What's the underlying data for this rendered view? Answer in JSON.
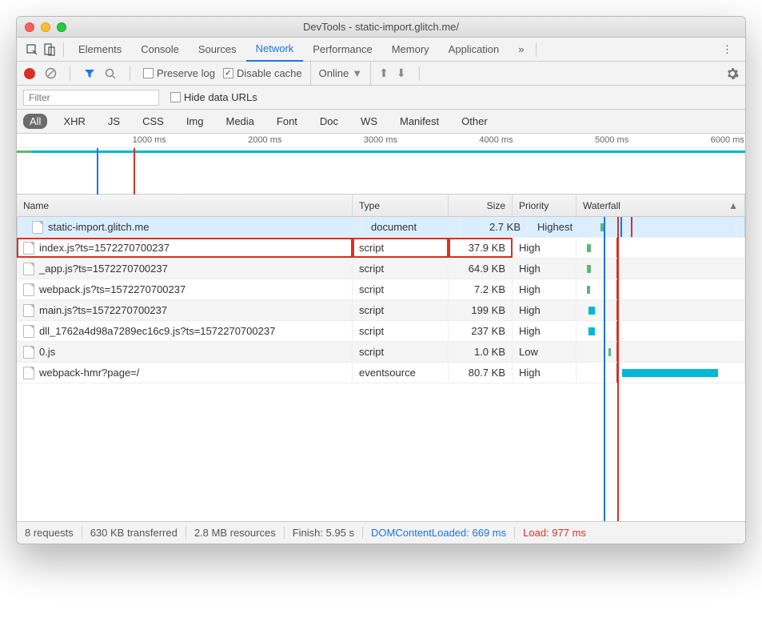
{
  "window": {
    "title": "DevTools - static-import.glitch.me/"
  },
  "tabs": [
    "Elements",
    "Console",
    "Sources",
    "Network",
    "Performance",
    "Memory",
    "Application"
  ],
  "activeTab": "Network",
  "toolbar": {
    "preserve_log": "Preserve log",
    "disable_cache": "Disable cache",
    "throttle": "Online"
  },
  "filter": {
    "placeholder": "Filter",
    "hide_urls": "Hide data URLs"
  },
  "types": [
    "All",
    "XHR",
    "JS",
    "CSS",
    "Img",
    "Media",
    "Font",
    "Doc",
    "WS",
    "Manifest",
    "Other"
  ],
  "activeType": "All",
  "overview": {
    "ticks": [
      "1000 ms",
      "2000 ms",
      "3000 ms",
      "4000 ms",
      "5000 ms",
      "6000 ms"
    ]
  },
  "columns": {
    "name": "Name",
    "type": "Type",
    "size": "Size",
    "priority": "Priority",
    "waterfall": "Waterfall"
  },
  "rows": [
    {
      "name": "static-import.glitch.me",
      "type": "document",
      "size": "2.7 KB",
      "priority": "Highest",
      "selected": true,
      "wfStart": 2,
      "wfWidth": 4,
      "wfColor": "#5bb974"
    },
    {
      "name": "index.js?ts=1572270700237",
      "type": "script",
      "size": "37.9 KB",
      "priority": "High",
      "highlight": true,
      "wfStart": 6,
      "wfWidth": 5,
      "wfColor": "#5bb974"
    },
    {
      "name": "_app.js?ts=1572270700237",
      "type": "script",
      "size": "64.9 KB",
      "priority": "High",
      "wfStart": 6,
      "wfWidth": 5,
      "wfColor": "#5bb974"
    },
    {
      "name": "webpack.js?ts=1572270700237",
      "type": "script",
      "size": "7.2 KB",
      "priority": "High",
      "wfStart": 6,
      "wfWidth": 4,
      "wfColor": "#5bb974"
    },
    {
      "name": "main.js?ts=1572270700237",
      "type": "script",
      "size": "199 KB",
      "priority": "High",
      "wfStart": 7,
      "wfWidth": 8,
      "wfColor": "#00b8d4"
    },
    {
      "name": "dll_1762a4d98a7289ec16c9.js?ts=1572270700237",
      "type": "script",
      "size": "237 KB",
      "priority": "High",
      "wfStart": 7,
      "wfWidth": 8,
      "wfColor": "#00b8d4"
    },
    {
      "name": "0.js",
      "type": "script",
      "size": "1.0 KB",
      "priority": "Low",
      "wfStart": 19,
      "wfWidth": 3,
      "wfColor": "#5bb974"
    },
    {
      "name": "webpack-hmr?page=/",
      "type": "eventsource",
      "size": "80.7 KB",
      "priority": "High",
      "wfStart": 27,
      "wfWidth": 120,
      "wfColor": "#00b8d4"
    }
  ],
  "markers": {
    "blue_pct": 16,
    "red_pct": 24
  },
  "status": {
    "requests": "8 requests",
    "transferred": "630 KB transferred",
    "resources": "2.8 MB resources",
    "finish": "Finish: 5.95 s",
    "dcl": "DOMContentLoaded: 669 ms",
    "load": "Load: 977 ms"
  }
}
